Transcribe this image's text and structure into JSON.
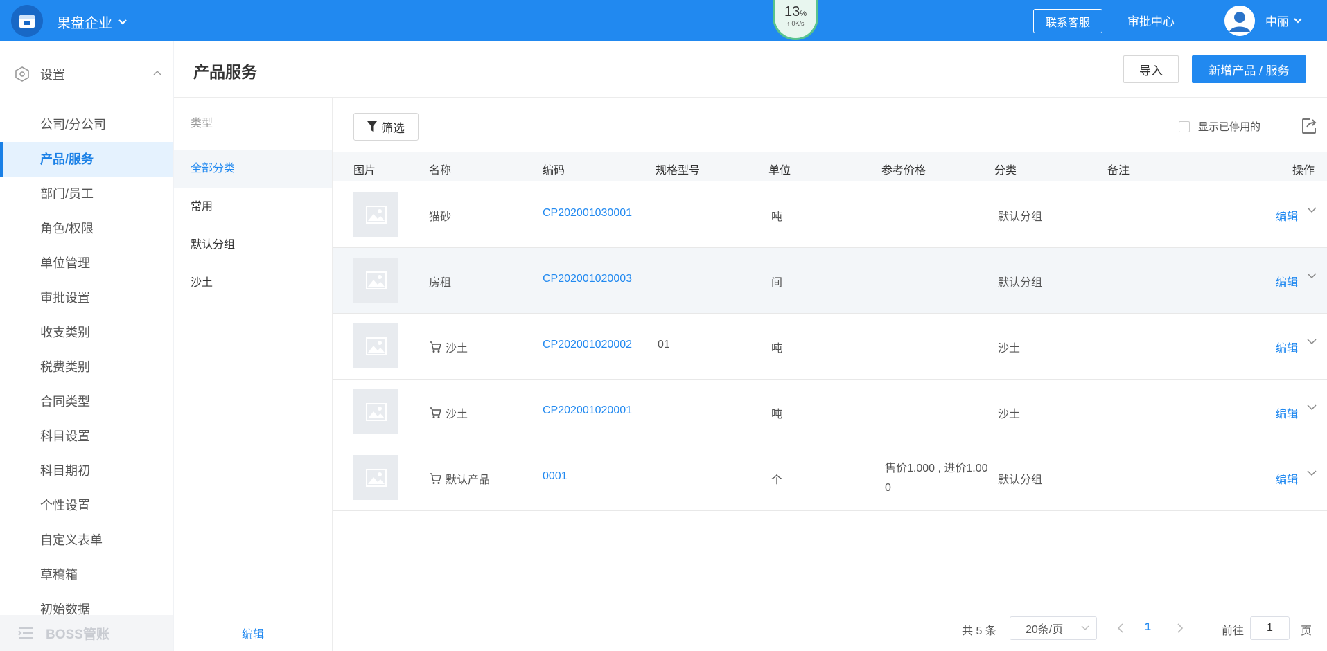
{
  "topbar": {
    "company": "果盘企业",
    "speed_percent": "13",
    "speed_unit": "%",
    "speed_rate": "↑ 0K/s",
    "contact_label": "联系客服",
    "approval_label": "审批中心",
    "username": "中丽"
  },
  "sidebar": {
    "section_label": "设置",
    "items": [
      {
        "label": "公司/分公司"
      },
      {
        "label": "产品/服务"
      },
      {
        "label": "部门/员工"
      },
      {
        "label": "角色/权限"
      },
      {
        "label": "单位管理"
      },
      {
        "label": "审批设置"
      },
      {
        "label": "收支类别"
      },
      {
        "label": "税费类别"
      },
      {
        "label": "合同类型"
      },
      {
        "label": "科目设置"
      },
      {
        "label": "科目期初"
      },
      {
        "label": "个性设置"
      },
      {
        "label": "自定义表单"
      },
      {
        "label": "草稿箱"
      },
      {
        "label": "初始数据"
      }
    ],
    "bottom_label": "BOSS管账"
  },
  "page": {
    "title": "产品服务",
    "import_label": "导入",
    "add_label": "新增产品 / 服务"
  },
  "categories": {
    "header": "类型",
    "items": [
      {
        "label": "全部分类"
      },
      {
        "label": "常用"
      },
      {
        "label": "默认分组"
      },
      {
        "label": "沙土"
      }
    ],
    "edit_label": "编辑"
  },
  "toolbar": {
    "filter_label": "筛选",
    "show_disabled_label": "显示已停用的"
  },
  "table": {
    "columns": [
      "图片",
      "名称",
      "编码",
      "规格型号",
      "单位",
      "参考价格",
      "分类",
      "备注",
      "操作"
    ],
    "rows": [
      {
        "name": "猫砂",
        "code": "CP202001030001",
        "spec": "",
        "unit": "吨",
        "price": "",
        "category": "默认分组",
        "note": "",
        "edit": "编辑"
      },
      {
        "name": "房租",
        "code": "CP202001020003",
        "spec": "",
        "unit": "间",
        "price": "",
        "category": "默认分组",
        "note": "",
        "edit": "编辑"
      },
      {
        "name": "沙土",
        "code": "CP202001020002",
        "spec": "01",
        "unit": "吨",
        "price": "",
        "category": "沙土",
        "note": "",
        "edit": "编辑"
      },
      {
        "name": "沙土",
        "code": "CP202001020001",
        "spec": "",
        "unit": "吨",
        "price": "",
        "category": "沙土",
        "note": "",
        "edit": "编辑"
      },
      {
        "name": "默认产品",
        "code": "0001",
        "spec": "",
        "unit": "个",
        "price": "售价1.000 , 进价1.000",
        "category": "默认分组",
        "note": "",
        "edit": "编辑"
      }
    ]
  },
  "pagination": {
    "total": "共 5 条",
    "page_size": "20条/页",
    "current_page": "1",
    "goto_label": "前往",
    "goto_value": "1",
    "page_suffix": "页"
  },
  "colors": {
    "primary": "#2189f0",
    "topbar": "#2189f0",
    "active_bg": "#e5f2fe"
  },
  "icons": {
    "logo": "store-icon",
    "filter": "filter-icon",
    "export": "export-icon",
    "cart": "cart-icon",
    "image_placeholder": "image-icon"
  }
}
